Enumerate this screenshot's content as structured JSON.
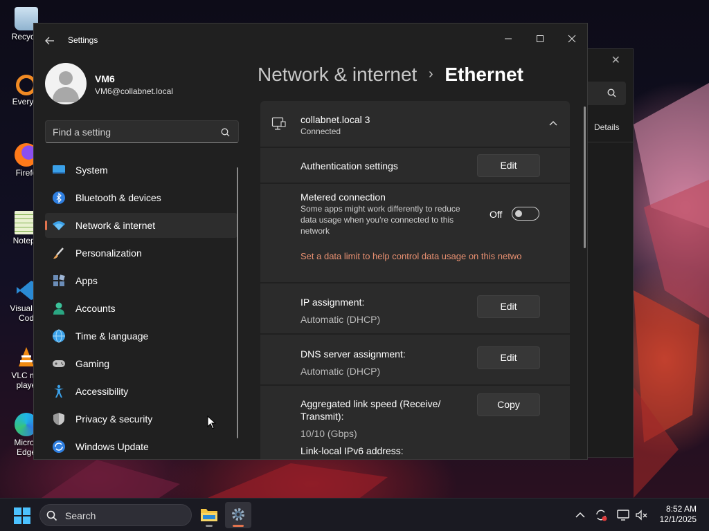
{
  "desktop": {
    "icons": [
      {
        "name": "recycle-bin",
        "label": "Recycle"
      },
      {
        "name": "everything",
        "label": "Everyth"
      },
      {
        "name": "firefox",
        "label": "Firefo"
      },
      {
        "name": "notepad",
        "label": "Notepa"
      },
      {
        "name": "visual-studio-code",
        "label": "Visual St\nCod"
      },
      {
        "name": "vlc",
        "label": "VLC me\nplaye"
      },
      {
        "name": "edge",
        "label": "Micros\nEdge"
      }
    ]
  },
  "background_window": {
    "tab_label": "Details"
  },
  "settings": {
    "app_title": "Settings",
    "account": {
      "name": "VM6",
      "email": "VM6@collabnet.local"
    },
    "search": {
      "placeholder": "Find a setting"
    },
    "nav": [
      {
        "label": "System",
        "icon": "system-icon",
        "active": false
      },
      {
        "label": "Bluetooth & devices",
        "icon": "bluetooth-icon",
        "active": false
      },
      {
        "label": "Network & internet",
        "icon": "network-icon",
        "active": true
      },
      {
        "label": "Personalization",
        "icon": "brush-icon",
        "active": false
      },
      {
        "label": "Apps",
        "icon": "apps-icon",
        "active": false
      },
      {
        "label": "Accounts",
        "icon": "accounts-icon",
        "active": false
      },
      {
        "label": "Time & language",
        "icon": "globe-icon",
        "active": false
      },
      {
        "label": "Gaming",
        "icon": "gamepad-icon",
        "active": false
      },
      {
        "label": "Accessibility",
        "icon": "accessibility-icon",
        "active": false
      },
      {
        "label": "Privacy & security",
        "icon": "shield-icon",
        "active": false
      },
      {
        "label": "Windows Update",
        "icon": "update-icon",
        "active": false
      }
    ],
    "breadcrumb": {
      "parent": "Network & internet",
      "separator": "›",
      "current": "Ethernet"
    },
    "connection": {
      "name": "collabnet.local 3",
      "status": "Connected"
    },
    "auth": {
      "label": "Authentication settings",
      "button": "Edit"
    },
    "metered": {
      "label": "Metered connection",
      "description": "Some apps might work differently to reduce data usage when you're connected to this network",
      "toggle_state": "Off",
      "toggle_on": false,
      "link": "Set a data limit to help control data usage on this netwo"
    },
    "ip": {
      "label": "IP assignment:",
      "value": "Automatic (DHCP)",
      "button": "Edit"
    },
    "dns": {
      "label": "DNS server assignment:",
      "value": "Automatic (DHCP)",
      "button": "Edit"
    },
    "link_speed": {
      "label": "Aggregated link speed (Receive/ Transmit):",
      "value": "10/10 (Gbps)",
      "button": "Copy"
    },
    "ipv6": {
      "label": "Link-local IPv6 address:"
    }
  },
  "taskbar": {
    "search_label": "Search",
    "time": "8:52 AM",
    "date": "12/1/2025"
  },
  "colors": {
    "accent": "#e2734e",
    "link": "#e89071",
    "window_bg": "#202020",
    "card_bg": "#2b2b2b"
  }
}
